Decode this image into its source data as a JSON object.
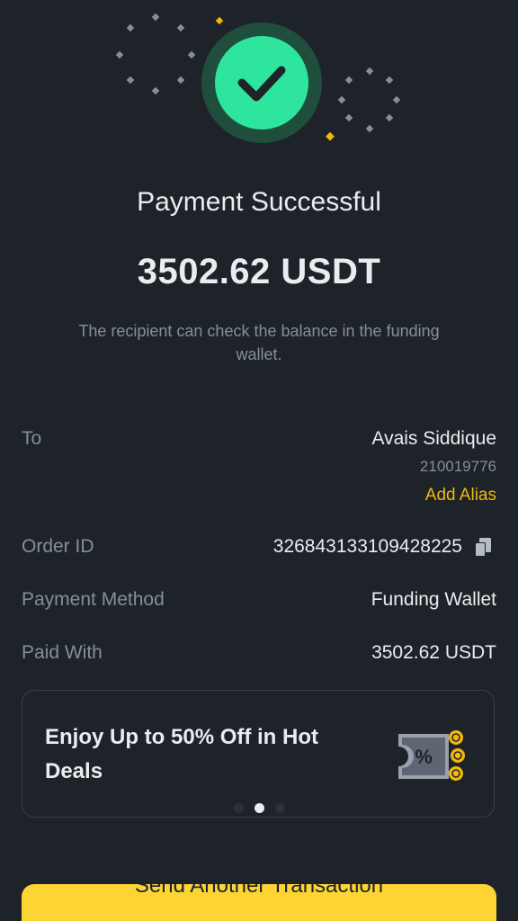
{
  "header": {
    "title": "Payment Successful",
    "amount": "3502.62 USDT",
    "subtitle": "The recipient can check the balance in the funding wallet."
  },
  "details": {
    "to_label": "To",
    "to_name": "Avais Siddique",
    "to_uid": "210019776",
    "add_alias_label": "Add Alias",
    "order_id_label": "Order ID",
    "order_id_value": "326843133109428225",
    "payment_method_label": "Payment Method",
    "payment_method_value": "Funding Wallet",
    "paid_with_label": "Paid With",
    "paid_with_value": "3502.62 USDT"
  },
  "banner": {
    "text": "Enjoy Up to 50% Off in Hot Deals",
    "art_icon": "coupon-coins-icon",
    "carousel_count": 3,
    "carousel_active": 1
  },
  "cta": {
    "label": "Send Another Transaction"
  },
  "colors": {
    "background": "#1e2329",
    "success_green": "#2ee59d",
    "accent_yellow": "#f0b90b",
    "button_yellow": "#fcd535",
    "muted_text": "#848e9c"
  }
}
